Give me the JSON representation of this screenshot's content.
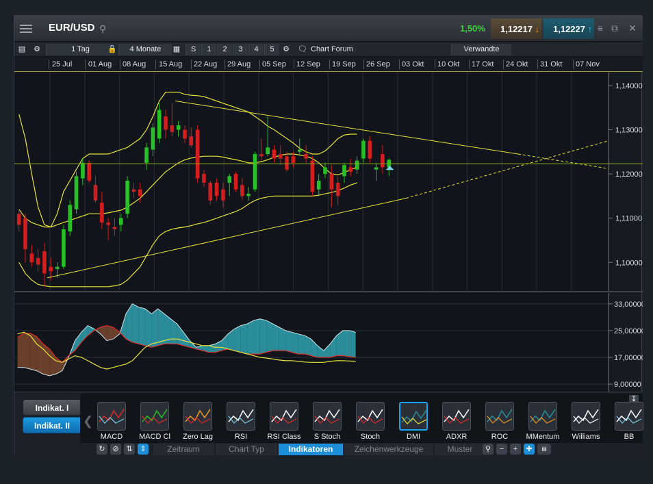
{
  "header": {
    "symbol": "EUR/USD",
    "change": "1,50%",
    "sell_price": "1,12217",
    "buy_price": "1,12227",
    "sell_arrow": "↓",
    "buy_arrow": "↑"
  },
  "toolbar": {
    "interval": "1 Tag",
    "range": "4 Monate",
    "quick": [
      "S",
      "1",
      "2",
      "3",
      "4",
      "5"
    ],
    "forum": "Chart Forum",
    "related": "Verwandte"
  },
  "date_axis": [
    "25 Jul",
    "01 Aug",
    "08 Aug",
    "15 Aug",
    "22 Aug",
    "29 Aug",
    "05 Sep",
    "12 Sep",
    "19 Sep",
    "26 Sep",
    "03 Okt",
    "10 Okt",
    "17 Okt",
    "24 Okt",
    "31 Okt",
    "07 Nov"
  ],
  "colors": {
    "up": "#27c127",
    "down": "#d21e1e",
    "indicator": "#e8e23a",
    "dmi_fill": "#2a8d99"
  },
  "chart_data": [
    {
      "type": "candlestick",
      "ylim": [
        1.094,
        1.142
      ],
      "yticks": [
        "1,14000",
        "1,13000",
        "1,12000",
        "1,11000",
        "1,10000"
      ],
      "candles": [
        {
          "o": 1.111,
          "h": 1.112,
          "l": 1.107,
          "c": 1.1085
        },
        {
          "o": 1.11,
          "h": 1.111,
          "l": 1.1,
          "c": 1.103
        },
        {
          "o": 1.102,
          "h": 1.104,
          "l": 1.099,
          "c": 1.1
        },
        {
          "o": 1.101,
          "h": 1.103,
          "l": 1.098,
          "c": 1.0995
        },
        {
          "o": 1.1025,
          "h": 1.1045,
          "l": 1.0945,
          "c": 1.0975
        },
        {
          "o": 1.099,
          "h": 1.101,
          "l": 1.096,
          "c": 1.098
        },
        {
          "o": 1.0985,
          "h": 1.1,
          "l": 1.0965,
          "c": 1.099
        },
        {
          "o": 1.099,
          "h": 1.1085,
          "l": 1.0985,
          "c": 1.1075
        },
        {
          "o": 1.107,
          "h": 1.114,
          "l": 1.106,
          "c": 1.113
        },
        {
          "o": 1.112,
          "h": 1.1205,
          "l": 1.111,
          "c": 1.1195
        },
        {
          "o": 1.119,
          "h": 1.1235,
          "l": 1.1175,
          "c": 1.1225
        },
        {
          "o": 1.1225,
          "h": 1.123,
          "l": 1.118,
          "c": 1.1185
        },
        {
          "o": 1.1175,
          "h": 1.1195,
          "l": 1.1135,
          "c": 1.114
        },
        {
          "o": 1.1135,
          "h": 1.116,
          "l": 1.1075,
          "c": 1.109
        },
        {
          "o": 1.109,
          "h": 1.11,
          "l": 1.105,
          "c": 1.1085
        },
        {
          "o": 1.108,
          "h": 1.11,
          "l": 1.106,
          "c": 1.1075
        },
        {
          "o": 1.1085,
          "h": 1.111,
          "l": 1.107,
          "c": 1.11
        },
        {
          "o": 1.111,
          "h": 1.1195,
          "l": 1.11,
          "c": 1.1185
        },
        {
          "o": 1.1165,
          "h": 1.118,
          "l": 1.1145,
          "c": 1.116
        },
        {
          "o": 1.1165,
          "h": 1.118,
          "l": 1.1135,
          "c": 1.115
        },
        {
          "o": 1.1225,
          "h": 1.127,
          "l": 1.121,
          "c": 1.126
        },
        {
          "o": 1.1255,
          "h": 1.1315,
          "l": 1.124,
          "c": 1.1305
        },
        {
          "o": 1.128,
          "h": 1.136,
          "l": 1.127,
          "c": 1.1345
        },
        {
          "o": 1.133,
          "h": 1.1345,
          "l": 1.128,
          "c": 1.13
        },
        {
          "o": 1.131,
          "h": 1.136,
          "l": 1.1285,
          "c": 1.1295
        },
        {
          "o": 1.13,
          "h": 1.132,
          "l": 1.1285,
          "c": 1.131
        },
        {
          "o": 1.13,
          "h": 1.131,
          "l": 1.127,
          "c": 1.128
        },
        {
          "o": 1.1285,
          "h": 1.1305,
          "l": 1.126,
          "c": 1.1265
        },
        {
          "o": 1.13,
          "h": 1.131,
          "l": 1.118,
          "c": 1.119
        },
        {
          "o": 1.12,
          "h": 1.121,
          "l": 1.117,
          "c": 1.118
        },
        {
          "o": 1.118,
          "h": 1.1185,
          "l": 1.113,
          "c": 1.114
        },
        {
          "o": 1.118,
          "h": 1.119,
          "l": 1.114,
          "c": 1.115
        },
        {
          "o": 1.1165,
          "h": 1.118,
          "l": 1.1125,
          "c": 1.114
        },
        {
          "o": 1.118,
          "h": 1.12,
          "l": 1.115,
          "c": 1.1195
        },
        {
          "o": 1.12,
          "h": 1.1205,
          "l": 1.116,
          "c": 1.1165
        },
        {
          "o": 1.1175,
          "h": 1.119,
          "l": 1.114,
          "c": 1.115
        },
        {
          "o": 1.115,
          "h": 1.117,
          "l": 1.114,
          "c": 1.1155
        },
        {
          "o": 1.1165,
          "h": 1.125,
          "l": 1.116,
          "c": 1.1245
        },
        {
          "o": 1.1245,
          "h": 1.128,
          "l": 1.123,
          "c": 1.124
        },
        {
          "o": 1.1245,
          "h": 1.133,
          "l": 1.124,
          "c": 1.126
        },
        {
          "o": 1.1255,
          "h": 1.1265,
          "l": 1.1225,
          "c": 1.1235
        },
        {
          "o": 1.1245,
          "h": 1.1265,
          "l": 1.122,
          "c": 1.1235
        },
        {
          "o": 1.124,
          "h": 1.125,
          "l": 1.1205,
          "c": 1.121
        },
        {
          "o": 1.124,
          "h": 1.125,
          "l": 1.1215,
          "c": 1.1225
        },
        {
          "o": 1.125,
          "h": 1.128,
          "l": 1.124,
          "c": 1.1255
        },
        {
          "o": 1.1245,
          "h": 1.1265,
          "l": 1.1225,
          "c": 1.1235
        },
        {
          "o": 1.123,
          "h": 1.124,
          "l": 1.115,
          "c": 1.116
        },
        {
          "o": 1.1165,
          "h": 1.12,
          "l": 1.115,
          "c": 1.1185
        },
        {
          "o": 1.12,
          "h": 1.1225,
          "l": 1.119,
          "c": 1.1215
        },
        {
          "o": 1.12,
          "h": 1.122,
          "l": 1.1125,
          "c": 1.1165
        },
        {
          "o": 1.118,
          "h": 1.1195,
          "l": 1.113,
          "c": 1.115
        },
        {
          "o": 1.1195,
          "h": 1.1225,
          "l": 1.118,
          "c": 1.122
        },
        {
          "o": 1.1215,
          "h": 1.1235,
          "l": 1.1195,
          "c": 1.1205
        },
        {
          "o": 1.121,
          "h": 1.124,
          "l": 1.12,
          "c": 1.123
        },
        {
          "o": 1.1235,
          "h": 1.128,
          "l": 1.1225,
          "c": 1.1275
        },
        {
          "o": 1.1275,
          "h": 1.1285,
          "l": 1.1225,
          "c": 1.1235
        },
        {
          "o": 1.121,
          "h": 1.1225,
          "l": 1.1185,
          "c": 1.1215
        },
        {
          "o": 1.1245,
          "h": 1.1265,
          "l": 1.12,
          "c": 1.1215
        },
        {
          "o": 1.1215,
          "h": 1.1235,
          "l": 1.1195,
          "c": 1.1232
        }
      ],
      "upper_band": [
        1.1335,
        1.128,
        1.12,
        1.1125,
        1.1085,
        1.108,
        1.111,
        1.116,
        1.1185,
        1.121,
        1.1235,
        1.1245,
        1.1245,
        1.1245,
        1.1245,
        1.125,
        1.1255,
        1.126,
        1.127,
        1.128,
        1.13,
        1.133,
        1.1365,
        1.1385,
        1.1385,
        1.1385,
        1.138,
        1.1378,
        1.1377,
        1.1375,
        1.137,
        1.1365,
        1.136,
        1.1355,
        1.135,
        1.1345,
        1.134,
        1.133,
        1.132,
        1.1308,
        1.13,
        1.129,
        1.128,
        1.127,
        1.1258,
        1.125,
        1.1245,
        1.1245,
        1.1252,
        1.1265,
        1.128,
        1.1288,
        1.129,
        1.129
      ],
      "middle_band": [
        1.112,
        1.11,
        1.109,
        1.1085,
        1.108,
        1.108,
        1.1085,
        1.109,
        1.1095,
        1.11,
        1.1105,
        1.111,
        1.111,
        1.111,
        1.1112,
        1.1115,
        1.1118,
        1.1125,
        1.1135,
        1.1145,
        1.116,
        1.1175,
        1.119,
        1.1205,
        1.1215,
        1.1225,
        1.1232,
        1.1236,
        1.1238,
        1.124,
        1.124,
        1.124,
        1.1238,
        1.1235,
        1.1232,
        1.1229,
        1.1225,
        1.1225,
        1.1228,
        1.1232,
        1.1238,
        1.1242,
        1.1245,
        1.1245,
        1.1243,
        1.124,
        1.1235,
        1.1225,
        1.1212,
        1.12,
        1.1198,
        1.1203,
        1.121,
        1.1215
      ],
      "lower_band": [
        1.1,
        1.0975,
        1.096,
        1.095,
        1.0947,
        1.0945,
        1.0945,
        1.0945,
        1.0945,
        1.0945,
        1.0945,
        1.0945,
        1.0945,
        1.0945,
        1.0945,
        1.0947,
        1.095,
        1.096,
        1.0975,
        1.099,
        1.1015,
        1.104,
        1.106,
        1.107,
        1.1075,
        1.1078,
        1.108,
        1.1083,
        1.1087,
        1.109,
        1.1095,
        1.11,
        1.1105,
        1.111,
        1.1115,
        1.1122,
        1.1132,
        1.114,
        1.1145,
        1.1148,
        1.115,
        1.115,
        1.115,
        1.115,
        1.115,
        1.115,
        1.115,
        1.1152,
        1.1155,
        1.1158,
        1.1162,
        1.1168,
        1.1175,
        1.118
      ],
      "current_price": 1.1223
    },
    {
      "type": "area",
      "ylim": [
        8,
        35
      ],
      "yticks": [
        "33,00000",
        "25,00000",
        "17,00000",
        "9,00000"
      ],
      "series": [
        {
          "values": [
            23.0,
            24.2,
            24.2,
            23.2,
            21.0,
            19.5,
            17.0,
            15.5,
            17.5,
            19.0,
            21.5,
            23.5,
            25.0,
            26.0,
            26.5,
            26.0,
            24.5,
            22.5,
            21.5,
            21.0,
            20.5,
            20.0,
            20.5,
            21.0,
            21.0,
            21.0,
            20.5,
            20.0,
            19.5,
            19.0,
            18.5,
            18.5,
            19.0,
            19.5,
            19.0,
            18.5,
            18.0,
            18.0,
            18.0,
            18.5,
            19.0,
            19.0,
            19.0,
            18.5,
            18.0,
            18.0,
            17.5,
            17.0,
            17.0,
            17.0,
            17.5,
            17.5,
            17.2,
            17.0
          ]
        },
        {
          "values": [
            14.0,
            14.0,
            13.5,
            13.0,
            12.0,
            11.5,
            12.0,
            13.0,
            17.0,
            22.0,
            24.5,
            26.5,
            25.5,
            24.0,
            22.0,
            22.5,
            24.0,
            30.0,
            33.0,
            32.0,
            31.5,
            30.0,
            31.5,
            30.0,
            28.5,
            27.0,
            24.5,
            22.0,
            20.0,
            20.5,
            20.5,
            21.0,
            22.0,
            24.0,
            25.5,
            26.5,
            27.0,
            28.0,
            28.5,
            28.0,
            27.0,
            26.0,
            25.0,
            24.5,
            24.0,
            23.5,
            22.5,
            20.5,
            19.0,
            21.0,
            23.5,
            25.0,
            25.0,
            24.5
          ]
        },
        {
          "values": [
            24.0,
            24.5,
            23.5,
            21.0,
            19.5,
            17.5,
            16.0,
            15.5,
            16.5,
            17.5,
            17.0,
            16.0,
            15.0,
            14.0,
            13.5,
            14.0,
            14.5,
            15.0,
            16.0,
            18.0,
            20.0,
            21.0,
            21.5,
            22.0,
            22.5,
            22.5,
            22.0,
            21.5,
            21.0,
            20.5,
            20.5,
            20.0,
            20.0,
            19.5,
            19.0,
            18.5,
            18.0,
            17.5,
            17.0,
            16.8,
            16.5,
            16.2,
            16.0,
            16.0,
            15.8,
            15.6,
            15.5,
            15.5,
            15.5,
            15.8,
            16.0,
            16.0,
            15.9,
            15.8
          ]
        }
      ]
    }
  ],
  "indicators": {
    "tab1": "Indikat. I",
    "tab2": "Indikat. II",
    "items": [
      "MACD",
      "MACD Cl",
      "Zero Lag",
      "RSI",
      "RSI Class",
      "S Stoch",
      "Stoch",
      "DMI",
      "ADXR",
      "ROC",
      "MMentum",
      "Williams",
      "BB"
    ],
    "selected": "DMI"
  },
  "nav": {
    "tabs": [
      "Zeitraum",
      "Chart Typ",
      "Indikatoren",
      "Zeichenwerkzeuge",
      "Muster"
    ],
    "active": "Indikatoren"
  }
}
